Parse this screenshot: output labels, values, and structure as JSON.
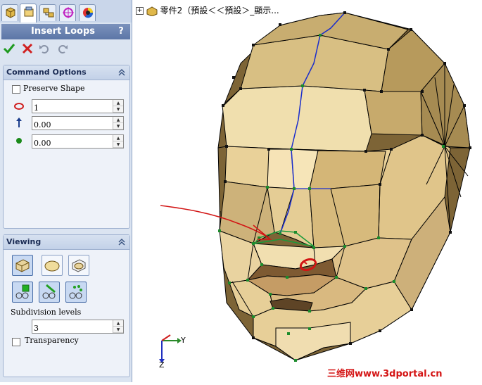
{
  "property_manager": {
    "tabs": [
      "feature-manager-icon",
      "property-manager-icon",
      "configuration-manager-icon",
      "dimxpert-icon",
      "display-manager-icon"
    ],
    "title": "Insert Loops",
    "help": "?",
    "actions": [
      "ok-icon",
      "cancel-icon",
      "undo-icon",
      "redo-icon"
    ],
    "command_options": {
      "header": "Command Options",
      "preserve_shape": {
        "label": "Preserve Shape",
        "checked": false
      },
      "loops_value": "1",
      "direction_value": "0.00",
      "offset_value": "0.00"
    },
    "viewing": {
      "header": "Viewing",
      "buttons_row1": [
        "box-view-icon",
        "smooth-view-icon",
        "box-smooth-view-icon"
      ],
      "buttons_row2": [
        "show-points-icon",
        "show-edges-icon",
        "show-vertices-icon"
      ],
      "subdivision_label": "Subdivision levels",
      "subdivision_value": "3",
      "transparency": {
        "label": "Transparency",
        "checked": false
      }
    }
  },
  "tree": {
    "part_label": "零件2（預設＜＜預設＞_顯示..."
  },
  "axes": {
    "y": "Y",
    "z": "Z"
  },
  "watermark": "三维网www.3dportal.cn",
  "colors": {
    "face": "#d6b77c",
    "edge": "#000000",
    "accent_edge": "#1a2dcc",
    "annotation": "#d21414"
  }
}
